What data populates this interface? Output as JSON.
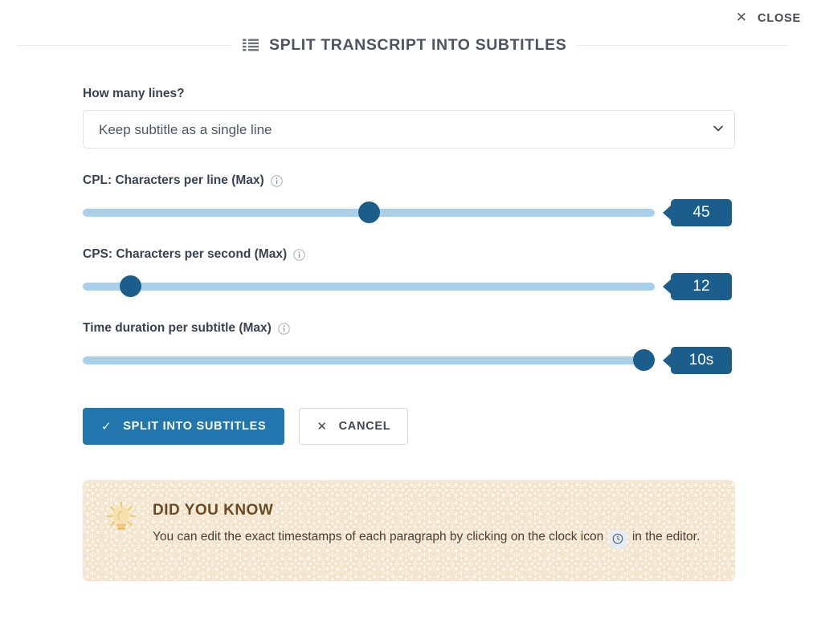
{
  "topbar": {
    "close_label": "CLOSE",
    "close_icon": "close-x-icon"
  },
  "header": {
    "title": "SPLIT TRANSCRIPT INTO SUBTITLES",
    "icon": "list-lines-icon"
  },
  "form": {
    "lines_field": {
      "label": "How many lines?",
      "selected": "Keep subtitle as a single line",
      "options": [
        "Keep subtitle as a single line"
      ],
      "chevron_icon": "chevron-down-icon"
    },
    "sliders": [
      {
        "label": "CPL: Characters per line (Max)",
        "info_icon": "info-circle-icon",
        "value": "45",
        "percent": 50
      },
      {
        "label": "CPS: Characters per second (Max)",
        "info_icon": "info-circle-icon",
        "value": "12",
        "percent": 8.3
      },
      {
        "label": "Time duration per subtitle (Max)",
        "info_icon": "info-circle-icon",
        "value": "10s",
        "percent": 98
      }
    ],
    "buttons": {
      "primary_label": "SPLIT INTO SUBTITLES",
      "primary_icon": "check-icon",
      "secondary_label": "CANCEL",
      "secondary_icon": "close-x-icon"
    }
  },
  "did_you_know": {
    "title": "DID YOU KNOW",
    "icon": "lightbulb-icon",
    "body_part1": "You can edit the exact timestamps of each paragraph by clicking on the clock icon",
    "inline_icon": "clock-icon",
    "body_part2": "in the editor."
  },
  "colors": {
    "accent_dark": "#1b5e8c",
    "accent": "#2176ae",
    "track": "#a8d0e8",
    "card_bg": "#fdf6ec",
    "card_border": "#f2e6d2",
    "card_title": "#6b4a23"
  }
}
